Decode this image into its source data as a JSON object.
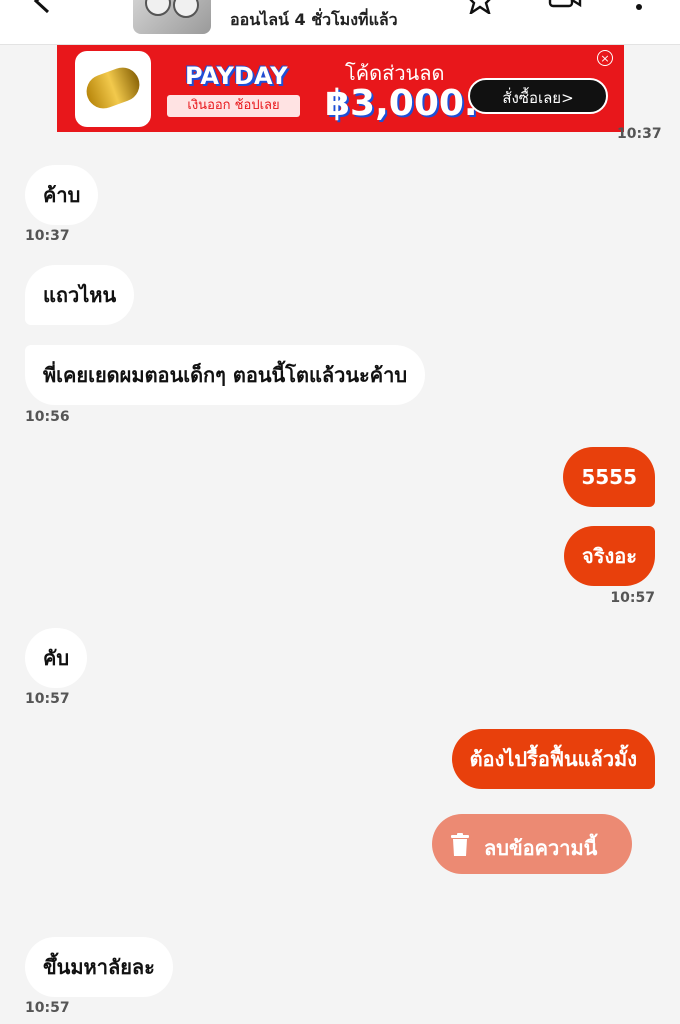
{
  "header": {
    "status": "ออนไลน์ 4 ชั่วโมงที่แล้ว",
    "back_icon": "chevron-left-icon",
    "star_icon": "star-icon",
    "video_icon": "video-icon",
    "more_icon": "more-vertical-icon"
  },
  "banner": {
    "title": "PAYDAY",
    "subtitle": "เงินออก ช้อปเลย",
    "code_label": "โค้ดส่วนลด",
    "code_amount": "฿3,000.-",
    "cta": "สั่งซื้อเลย>",
    "close_icon": "close-circle-icon"
  },
  "colors": {
    "background": "#f4f4f4",
    "incoming_bubble": "#ffffff",
    "outgoing_bubble": "#e8400c",
    "delete_button": "#ec8a73",
    "banner_red": "#e8171b"
  },
  "chat": {
    "top_time_partial": "10:37",
    "messages": [
      {
        "text": "ค้าบ",
        "dir": "in",
        "time": "10:37"
      },
      {
        "text": "แถวไหน",
        "dir": "in",
        "time": ""
      },
      {
        "text": "พี่เคยเยดผมตอนเด็กๆ ตอนนี้โตแล้วนะค้าบ",
        "dir": "in",
        "time": "10:56"
      },
      {
        "text": "5555",
        "dir": "out",
        "time": ""
      },
      {
        "text": "จริงอะ",
        "dir": "out",
        "time": "10:57"
      },
      {
        "text": "คับ",
        "dir": "in",
        "time": "10:57"
      },
      {
        "text": "ต้องไปรื้อฟื้นแล้วมั้ง",
        "dir": "out",
        "time": ""
      },
      {
        "text": "ขึ้นมหาลัยละ",
        "dir": "in",
        "time": "10:57"
      }
    ],
    "delete_button": "ลบข้อความนี้",
    "delete_icon": "trash-icon"
  }
}
